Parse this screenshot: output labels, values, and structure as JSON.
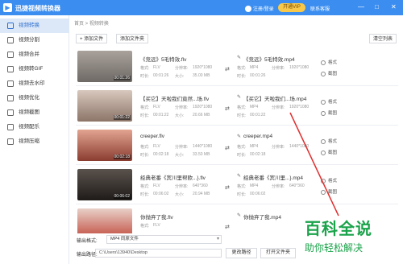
{
  "app": {
    "title": "迅捷视频转换器",
    "user": "注册/登录",
    "vip": "开通VIP",
    "contact": "联系客服"
  },
  "window_controls": [
    "—",
    "□",
    "✕"
  ],
  "sidebar": {
    "items": [
      {
        "label": "视频转换",
        "icon": "convert-icon"
      },
      {
        "label": "视频分割",
        "icon": "split-icon"
      },
      {
        "label": "视频合并",
        "icon": "merge-icon"
      },
      {
        "label": "视频转GIF",
        "icon": "gif-icon"
      },
      {
        "label": "视频去水印",
        "icon": "watermark-icon"
      },
      {
        "label": "视频优化",
        "icon": "optimize-icon"
      },
      {
        "label": "视频截图",
        "icon": "screenshot-icon"
      },
      {
        "label": "视频配乐",
        "icon": "music-icon"
      },
      {
        "label": "视频压缩",
        "icon": "compress-icon"
      }
    ],
    "active": 0
  },
  "breadcrumb": "首页 > 视频转换",
  "toolbar": {
    "add_file": "+ 添加文件",
    "add_folder": "添加文件夹",
    "clear_list": "清空列表"
  },
  "labels": {
    "format": "格式:",
    "resolution": "分辨率:",
    "duration": "时长:",
    "size": "大小:",
    "settings": "格式",
    "screenshot": "截图"
  },
  "files": [
    {
      "name": "《竞远》5毛特效.flv",
      "format": "FLV",
      "resolution": "1920*1080",
      "duration": "00:01:26",
      "size": "35.00 MB",
      "out_name": "《竞远》5毛特效.mp4",
      "out_format": "MP4",
      "out_resolution": "1920*1080",
      "out_duration": "00:01:26",
      "thumb_color": "#8f8a86"
    },
    {
      "name": "【买它】天啦我们竟然...场.flv",
      "format": "FLV",
      "resolution": "1920*1080",
      "duration": "00:01:22",
      "size": "20.66 MB",
      "out_name": "【买它】天啦我们...场.mp4",
      "out_format": "MP4",
      "out_resolution": "1920*1080",
      "out_duration": "00:01:22",
      "thumb_color": "#b7a39a"
    },
    {
      "name": "creeper.flv",
      "format": "FLV",
      "resolution": "1440*1080",
      "duration": "00:02:18",
      "size": "33.50 MB",
      "out_name": "creeper.mp4",
      "out_format": "MP4",
      "out_resolution": "1440*1080",
      "out_duration": "00:02:18",
      "thumb_color": "#c48a7c"
    },
    {
      "name": "经典老番《宾川里帮欧...}.flv",
      "format": "FLV",
      "resolution": "640*360",
      "duration": "00:06:02",
      "size": "20.94 MB",
      "out_name": "经典老番《宾川里...}.mp4",
      "out_format": "MP4",
      "out_resolution": "640*360",
      "out_duration": "00:06:02",
      "thumb_color": "#3f3a36"
    },
    {
      "name": "你抛弃了我.flv",
      "format": "FLV",
      "resolution": "",
      "duration": "",
      "size": "",
      "out_name": "你抛弃了我.mp4",
      "out_format": "",
      "out_resolution": "",
      "out_duration": "",
      "thumb_color": "#d35a4a"
    }
  ],
  "bottom": {
    "output_format_label": "输出格式:",
    "output_format_value": "MP4  同原文件",
    "output_path_label": "输出路径:",
    "output_path_value": "C:\\Users\\13940\\Desktop",
    "change_path": "更改路径",
    "open_folder": "打开文件夹",
    "convert_all": "全部转换"
  },
  "watermark": {
    "big": "百科全说",
    "small": "助你轻松解决"
  },
  "colors": {
    "accent": "#3b8ef0",
    "vip": "#f7c84a",
    "watermark": "#1aa34a",
    "annotation": "#e03030"
  }
}
